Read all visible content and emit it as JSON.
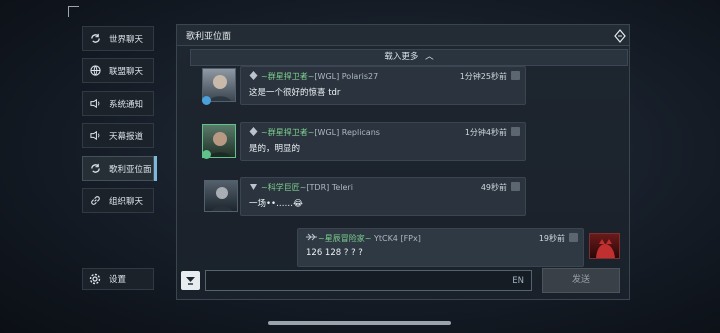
{
  "sidebar": {
    "items": [
      {
        "label": "世界聊天",
        "icon": "refresh-icon"
      },
      {
        "label": "联盟聊天",
        "icon": "globe-icon"
      },
      {
        "label": "系统通知",
        "icon": "speaker-icon"
      },
      {
        "label": "天幕报道",
        "icon": "speaker-icon"
      },
      {
        "label": "歌利亚位面",
        "icon": "refresh-icon"
      },
      {
        "label": "组织聊天",
        "icon": "link-icon"
      }
    ],
    "active_index": 4,
    "settings_label": "设置"
  },
  "panel": {
    "title": "歌利亚位面",
    "load_more": "载入更多"
  },
  "messages": [
    {
      "guild": "~群星捍卫者~",
      "tag": "[WGL]",
      "name": "Polaris27",
      "time": "1分钟25秒前",
      "text": "这是一个很好的惊喜 tdr"
    },
    {
      "guild": "~群星捍卫者~",
      "tag": "[WGL]",
      "name": "Replicans",
      "time": "1分钟4秒前",
      "text": "是的，明显的"
    },
    {
      "guild": "~科学巨匠~",
      "tag": "[TDR]",
      "name": "Teleri",
      "time": "49秒前",
      "text": "一场••……😂"
    },
    {
      "guild": "~星辰冒险家~",
      "tag": "YtCK4",
      "name": "[FPx]",
      "time": "19秒前",
      "text": "126 128 ? ? ?"
    }
  ],
  "input": {
    "lang": "EN",
    "send_label": "发送"
  },
  "colors": {
    "guild": "#7fd190",
    "accent": "#7fb7d8"
  }
}
